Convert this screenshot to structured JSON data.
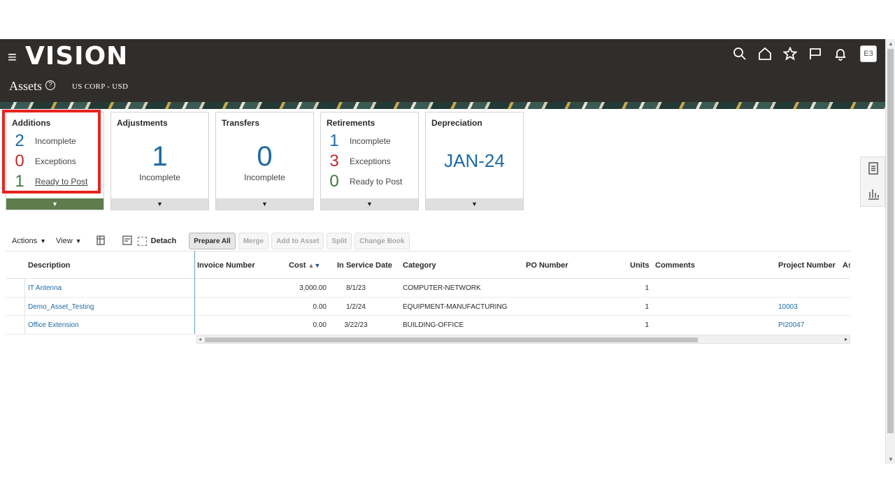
{
  "app": {
    "logo": "VISION",
    "menu_icon": "hamburger-icon"
  },
  "header": {
    "icons": [
      "search-icon",
      "home-icon",
      "star-icon",
      "flag-icon",
      "bell-icon"
    ],
    "avatar_initials": "E3",
    "page_title": "Assets",
    "context": "US CORP - USD"
  },
  "tiles": {
    "additions": {
      "title": "Additions",
      "rows": [
        {
          "count": "2",
          "label": "Incomplete"
        },
        {
          "count": "0",
          "label": "Exceptions"
        },
        {
          "count": "1",
          "label": "Ready to Post"
        }
      ]
    },
    "adjustments": {
      "title": "Adjustments",
      "count": "1",
      "label": "Incomplete"
    },
    "transfers": {
      "title": "Transfers",
      "count": "0",
      "label": "Incomplete"
    },
    "retirements": {
      "title": "Retirements",
      "rows": [
        {
          "count": "1",
          "label": "Incomplete"
        },
        {
          "count": "3",
          "label": "Exceptions"
        },
        {
          "count": "0",
          "label": "Ready to Post"
        }
      ]
    },
    "depreciation": {
      "title": "Depreciation",
      "period": "JAN-24"
    },
    "expand_icon": "▼"
  },
  "toolbar": {
    "actions": "Actions",
    "view": "View",
    "detach": "Detach",
    "buttons": [
      "Prepare All",
      "Merge",
      "Add to Asset",
      "Split",
      "Change Book"
    ]
  },
  "table": {
    "headers": [
      "Description",
      "Invoice Number",
      "Cost",
      "In Service Date",
      "Category",
      "PO Number",
      "Units",
      "Comments",
      "Project Number",
      "As"
    ],
    "rows": [
      {
        "description": "IT Antenna",
        "invoice": "",
        "cost": "3,000.00",
        "date": "8/1/23",
        "category": "COMPUTER-NETWORK",
        "po": "",
        "units": "1",
        "comments": "",
        "project": ""
      },
      {
        "description": "Demo_Asset_Testing",
        "invoice": "",
        "cost": "0.00",
        "date": "1/2/24",
        "category": "EQUIPMENT-MANUFACTURING",
        "po": "",
        "units": "1",
        "comments": "",
        "project": "10003"
      },
      {
        "description": "Office Extension",
        "invoice": "",
        "cost": "0.00",
        "date": "3/22/23",
        "category": "BUILDING-OFFICE",
        "po": "",
        "units": "1",
        "comments": "",
        "project": "PI20047"
      }
    ]
  },
  "colors": {
    "header_bg": "#312d2a",
    "accent_blue": "#1b6aa6",
    "exception_red": "#c02a2a",
    "ready_green": "#3c7c3c",
    "active_tile": "#5e7c4c",
    "highlight": "#e8221e"
  }
}
